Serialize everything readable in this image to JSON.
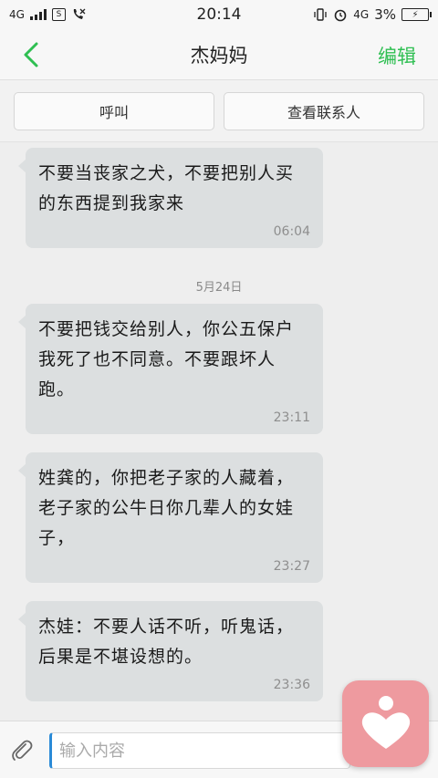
{
  "status_bar": {
    "network": "4G",
    "time": "20:14",
    "network_right": "4G",
    "battery": "3%"
  },
  "header": {
    "title": "杰妈妈",
    "edit_label": "编辑"
  },
  "actions": {
    "call_label": "呼叫",
    "view_contact_label": "查看联系人"
  },
  "messages": [
    {
      "text": "不要当丧家之犬，不要把别人买的东西提到我家来",
      "time": "06:04"
    },
    {
      "text": "不要把钱交给别人，你公五保户我死了也不同意。不要跟坏人跑。",
      "time": "23:11"
    },
    {
      "text": "姓龚的，你把老子家的人藏着，老子家的公牛日你几辈人的女娃子，",
      "time": "23:27"
    },
    {
      "text": "杰娃：不要人话不听，听鬼话，后果是不堪设想的。",
      "time": "23:36"
    }
  ],
  "date_separator": "5月24日",
  "input": {
    "placeholder": "输入内容"
  },
  "colors": {
    "accent_green": "#2fbf52",
    "bubble": "#dcdfe0",
    "widget_pink": "#ee9a9f"
  },
  "icons": [
    "back-chevron-icon",
    "paperclip-icon",
    "heart-person-icon",
    "signal-icon",
    "alarm-icon",
    "vibrate-icon"
  ]
}
